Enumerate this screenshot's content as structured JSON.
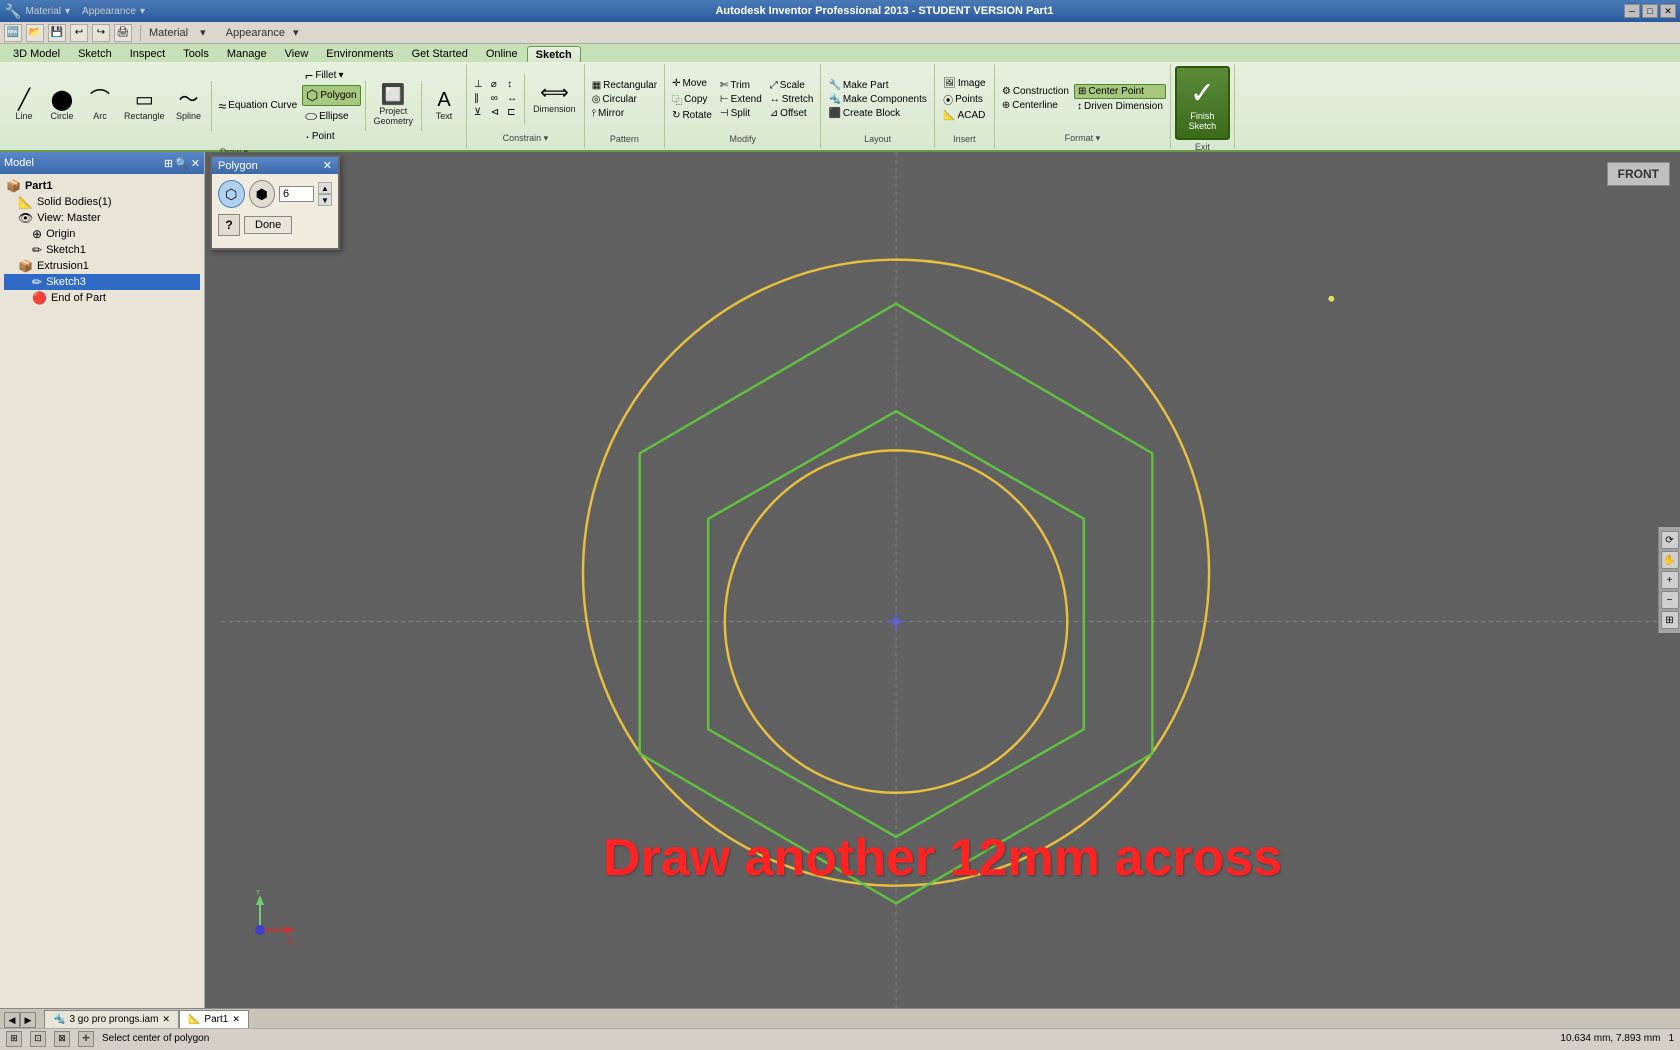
{
  "titlebar": {
    "title": "Autodesk Inventor Professional 2013 - STUDENT VERSION  Part1",
    "close_label": "✕",
    "minimize_label": "─",
    "maximize_label": "□"
  },
  "menubar": {
    "items": [
      "3D Model",
      "Sketch",
      "Inspect",
      "Tools",
      "Manage",
      "View",
      "Environments",
      "Get Started",
      "Online",
      "Sketch"
    ]
  },
  "ribbon": {
    "active_tab": "Sketch",
    "tabs": [
      "3D Model",
      "Sketch",
      "Inspect",
      "Tools",
      "Manage",
      "View",
      "Environments",
      "Get Started",
      "Online",
      "Sketch"
    ],
    "groups": {
      "draw": {
        "label": "Draw",
        "items": [
          "Line",
          "Circle",
          "Arc",
          "Rectangle",
          "Spline",
          "Equation Curve",
          "Fillet",
          "Polygon",
          "Ellipse",
          "Point",
          "Project Geometry",
          "Text"
        ]
      },
      "constrain": {
        "label": "Constrain",
        "items": [
          "Dimension"
        ]
      },
      "pattern": {
        "label": "Pattern",
        "items": [
          "Rectangular",
          "Circular",
          "Mirror"
        ]
      },
      "modify": {
        "label": "Modify",
        "items": [
          "Move",
          "Trim",
          "Scale",
          "Copy",
          "Extend",
          "Stretch",
          "Rotate",
          "Split",
          "Offset"
        ]
      },
      "layout": {
        "label": "Layout",
        "items": [
          "Make Part",
          "Make Components",
          "Create Block"
        ]
      },
      "insert": {
        "label": "Insert",
        "items": [
          "Image",
          "Points",
          "ACAD"
        ]
      },
      "format": {
        "label": "Format",
        "items": [
          "Construction",
          "Centerline",
          "Center Point",
          "Driven Dimension"
        ]
      },
      "exit": {
        "label": "Exit",
        "items": [
          "Finish Sketch"
        ]
      }
    }
  },
  "polygon_dialog": {
    "title": "Polygon",
    "sides_label": "6",
    "done_label": "Done",
    "help_label": "?"
  },
  "model_tree": {
    "title": "Model",
    "items": [
      {
        "label": "Part1",
        "indent": 0,
        "icon": "📦"
      },
      {
        "label": "Solid Bodies(1)",
        "indent": 1,
        "icon": "📐"
      },
      {
        "label": "View: Master",
        "indent": 1,
        "icon": "👁"
      },
      {
        "label": "Origin",
        "indent": 2,
        "icon": "⊕"
      },
      {
        "label": "Sketch1",
        "indent": 2,
        "icon": "✏"
      },
      {
        "label": "Extrusion1",
        "indent": 1,
        "icon": "📦"
      },
      {
        "label": "Sketch3",
        "indent": 2,
        "icon": "✏"
      },
      {
        "label": "End of Part",
        "indent": 2,
        "icon": "🔴"
      }
    ]
  },
  "canvas": {
    "view_label": "FRONT",
    "annotation": "Draw another 12mm across"
  },
  "statusbar": {
    "message": "Select center of polygon",
    "coords": "10.634 mm, 7.893 mm",
    "zoom_level": "1"
  },
  "tabbar": {
    "tabs": [
      "3 go pro prongs.iam",
      "Part1"
    ]
  }
}
